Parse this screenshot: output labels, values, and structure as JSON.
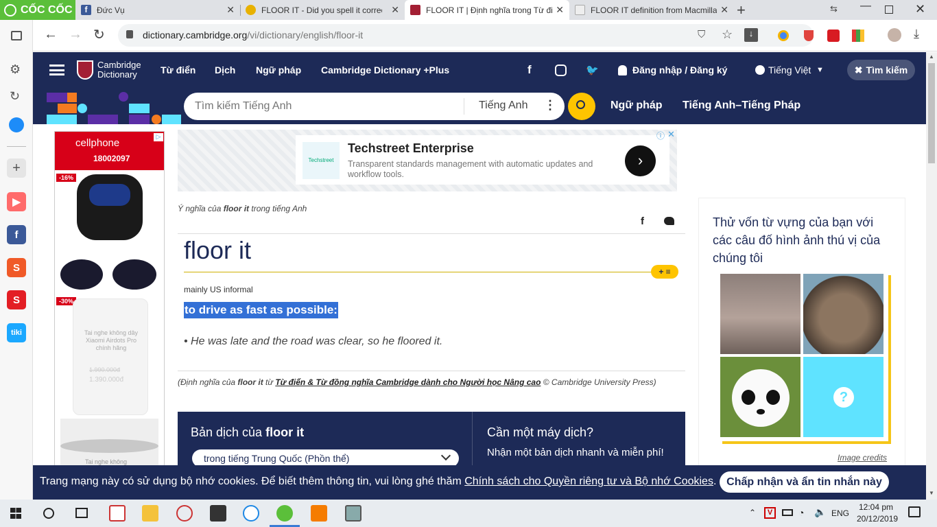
{
  "browser": {
    "logo_text": "CỐC CỐC",
    "tabs": [
      {
        "title": "Đức Vụ",
        "color": "#3b5998",
        "letter": "f"
      },
      {
        "title": "FLOOR IT - Did you spell it correctly?",
        "color": "#e8b100",
        "letter": "♦"
      },
      {
        "title": "FLOOR IT | Định nghĩa trong Từ điển",
        "color": "#a31f34",
        "letter": "C"
      },
      {
        "title": "FLOOR IT definition from Macmillan",
        "color": "#cccccc",
        "letter": "M"
      }
    ],
    "url_domain": "dictionary.cambridge.org",
    "url_path": "/vi/dictionary/english/floor-it"
  },
  "sidebar": {
    "items": [
      {
        "name": "youtube",
        "color": "#ff3d3d",
        "glyph": "▶"
      },
      {
        "name": "facebook",
        "color": "#3b5998",
        "glyph": "f"
      },
      {
        "name": "shopee",
        "color": "#f05a28",
        "glyph": "S"
      },
      {
        "name": "sendo",
        "color": "#e31e24",
        "glyph": "S"
      },
      {
        "name": "tiki",
        "color": "#1ba8ff",
        "glyph": "tiki"
      }
    ]
  },
  "site": {
    "logo_line1": "Cambridge",
    "logo_line2": "Dictionary",
    "nav": [
      "Từ điển",
      "Dịch",
      "Ngữ pháp",
      "Cambridge Dictionary +Plus"
    ],
    "login": "Đăng nhập / Đăng ký",
    "language": "Tiếng Việt",
    "search_button": "Tìm kiếm",
    "search_placeholder": "Tìm kiếm Tiếng Anh",
    "search_dict": "Tiếng Anh",
    "subnav": [
      "Ngữ pháp",
      "Tiếng Anh–Tiếng Pháp"
    ]
  },
  "left_ad": {
    "brand": "cellphone",
    "hotline": "18002097",
    "discount1": "-16%",
    "discount2": "-30%",
    "product_name": "Tai nghe không dây Xiaomi Airdots Pro chính hãng",
    "old_price": "1.990.000đ",
    "new_price": "1.390.000đ",
    "product_name2": "Tai nghe không"
  },
  "top_ad": {
    "title": "Techstreet Enterprise",
    "desc": "Transparent standards management with automatic updates and workflow tools.",
    "logo_text": "Techstreet"
  },
  "entry": {
    "meaning_prefix": "Ý nghĩa của ",
    "headword_bold": "floor it",
    "meaning_suffix": " trong tiếng Anh",
    "headword": "floor it",
    "labels": "mainly US informal",
    "definition": "to drive as fast as possible:",
    "example": "He was late and the road was clear, so he floored it.",
    "source_prefix": "(Định nghĩa của ",
    "source_word": "floor it",
    "source_mid": " từ ",
    "source_link": "Từ điển & Từ đồng nghĩa Cambridge dành cho Người học Nâng cao",
    "source_suffix": " © Cambridge University Press)"
  },
  "translation": {
    "title_prefix": "Bản dịch của ",
    "title_word": "floor it",
    "select_value": "trong tiếng Trung Quốc (Phồn thể)",
    "machine_title": "Cần một máy dịch?",
    "machine_text": "Nhận một bản dịch nhanh và miễn phí!"
  },
  "quiz": {
    "title": "Thử vốn từ vựng của bạn với các câu đố hình ảnh thú vị của chúng tôi",
    "credits": "Image credits",
    "question_mark": "?"
  },
  "cookie": {
    "text": "Trang mạng này có sử dụng bộ nhớ cookies. Để biết thêm thông tin, vui lòng ghé thăm ",
    "link": "Chính sách cho Quyền riêng tư và Bộ nhớ Cookies",
    "end": ".",
    "button": "Chấp nhận và ẩn tin nhắn này"
  },
  "taskbar": {
    "lang": "ENG",
    "time": "12:04 pm",
    "date": "20/12/2019"
  }
}
